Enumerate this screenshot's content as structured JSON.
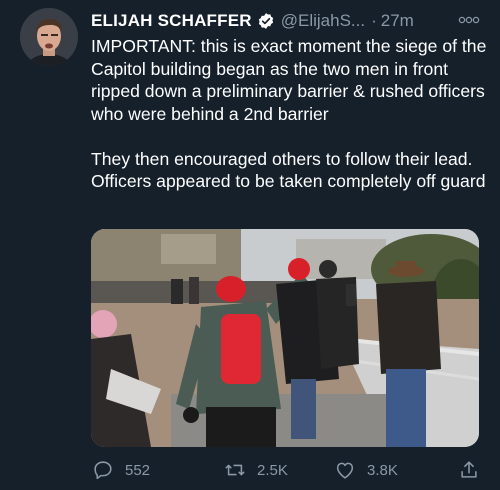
{
  "author": {
    "name": "ELIJAH SCHAFFER",
    "handle": "@ElijahS...",
    "separator": "·",
    "time": "27m"
  },
  "tweet": {
    "paragraph1": "IMPORTANT: this is exact moment the siege of the Capitol building began as the two men in front ripped down a preliminary barrier & rushed officers who were behind a 2nd barrier",
    "paragraph2": "They then encouraged others to follow their lead. Officers appeared to be taken completely off guard"
  },
  "actions": {
    "replies": "552",
    "retweets": "2.5K",
    "likes": "3.8K"
  },
  "colors": {
    "background": "#15202b",
    "secondary_text": "#8b98a5",
    "verified": "#ffffff"
  },
  "icons": [
    "verified-badge-icon",
    "more-options-icon",
    "reply-icon",
    "retweet-icon",
    "like-icon",
    "share-icon"
  ]
}
